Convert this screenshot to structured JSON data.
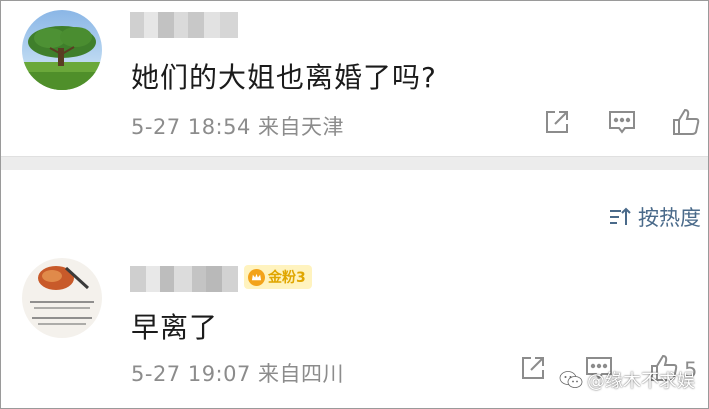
{
  "comments": [
    {
      "avatar_icon": "tree-landscape-avatar",
      "content": "她们的大姐也离婚了吗?",
      "meta": "5-27 18:54 来自天津"
    },
    {
      "avatar_icon": "calligraphy-avatar",
      "badge": "金粉3",
      "content": "早离了",
      "meta": "5-27 19:07 来自四川",
      "like_count": "5"
    }
  ],
  "sort": {
    "label": "按热度",
    "icon": "sort-icon"
  },
  "watermark": {
    "text": "@缘木不求娱",
    "icon": "wechat-icon"
  },
  "colors": {
    "badge_bg": "#fff3bf",
    "badge_text": "#e0a600",
    "link": "#4a6a8a",
    "meta": "#8c8c8c"
  }
}
